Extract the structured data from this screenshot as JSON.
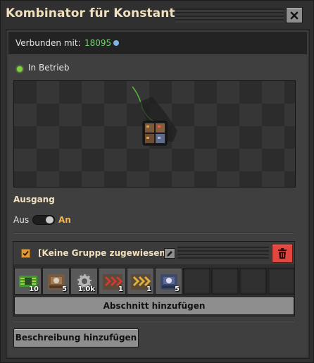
{
  "window": {
    "title": "Kombinator für Konstanten",
    "close_icon": "close-icon"
  },
  "connection": {
    "label": "Verbunden mit:",
    "network_id": "18095",
    "info_icon": "info-icon"
  },
  "status": {
    "text": "In Betrieb",
    "color": "#7bd33b"
  },
  "output": {
    "label": "Ausgang",
    "off_label": "Aus",
    "on_label": "An",
    "enabled": true
  },
  "group": {
    "checked": true,
    "name": "[Keine Gruppe zugewiesen]",
    "slots": [
      {
        "icon": "green-circuit-icon",
        "count": "10"
      },
      {
        "icon": "assembler-icon",
        "count": "5"
      },
      {
        "icon": "gear-icon",
        "count": "1.0k"
      },
      {
        "icon": "red-inserter-icon",
        "count": "1"
      },
      {
        "icon": "yellow-inserter-icon",
        "count": "1"
      },
      {
        "icon": "blue-assembler-icon",
        "count": "5"
      },
      {
        "icon": "empty-slot",
        "count": ""
      },
      {
        "icon": "empty-slot",
        "count": ""
      },
      {
        "icon": "empty-slot",
        "count": ""
      },
      {
        "icon": "empty-slot",
        "count": ""
      }
    ],
    "add_section_label": "Abschnitt hinzufügen"
  },
  "description": {
    "add_label": "Beschreibung hinzufügen"
  },
  "colors": {
    "title_text": "#f0e0c0",
    "accent_orange": "#f4b44b",
    "network_green": "#6fd26f",
    "delete_red": "#e2463f"
  }
}
